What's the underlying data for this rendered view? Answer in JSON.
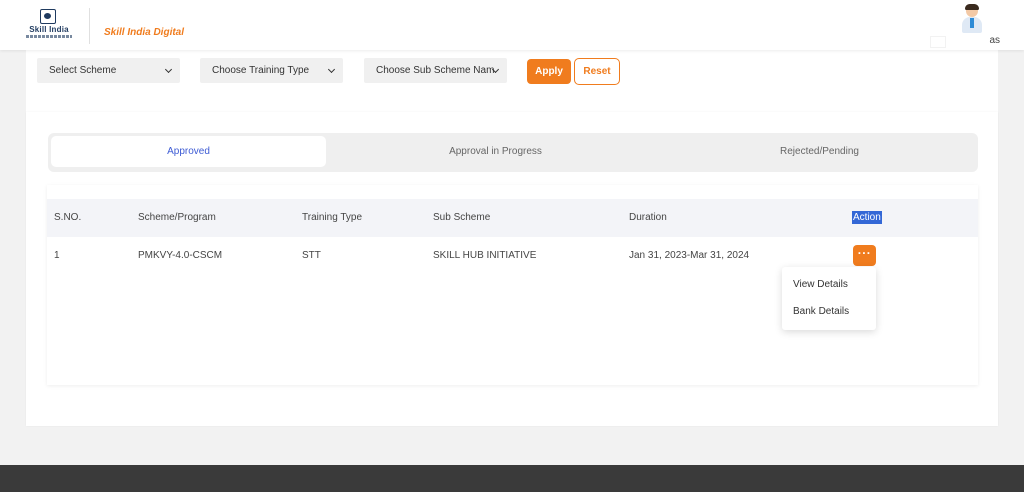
{
  "header": {
    "logo_text": "Skill India",
    "brand": "Skill India Digital",
    "user_name_fragment": "as"
  },
  "filters": {
    "scheme": "Select Scheme",
    "training_type": "Choose Training Type",
    "sub_scheme": "Choose Sub Scheme Nam",
    "apply_label": "Apply",
    "reset_label": "Reset"
  },
  "tabs": [
    {
      "label": "Approved",
      "active": true
    },
    {
      "label": "Approval in Progress",
      "active": false
    },
    {
      "label": "Rejected/Pending",
      "active": false
    }
  ],
  "table": {
    "columns": [
      "S.NO.",
      "Scheme/Program",
      "Training Type",
      "Sub Scheme",
      "Duration",
      "Action"
    ],
    "rows": [
      {
        "sno": "1",
        "scheme": "PMKVY-4.0-CSCM",
        "training_type": "STT",
        "sub_scheme": "SKILL HUB INITIATIVE",
        "duration": "Jan 31, 2023-Mar 31, 2024",
        "action": "···"
      }
    ]
  },
  "action_menu": {
    "items": [
      "View Details",
      "Bank Details"
    ]
  },
  "colors": {
    "accent": "#f07c1e",
    "active_tab_text": "#3d5bd4",
    "footer": "#3a3a3a"
  }
}
